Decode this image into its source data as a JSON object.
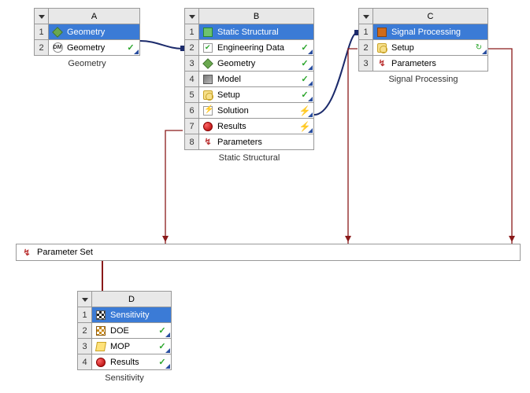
{
  "systems": {
    "A": {
      "letter": "A",
      "title": "Geometry",
      "caption": "Geometry",
      "rows": [
        {
          "n": "2",
          "icon": "dm",
          "label": "Geometry",
          "status": "check"
        }
      ]
    },
    "B": {
      "letter": "B",
      "title": "Static Structural",
      "caption": "Static Structural",
      "rows": [
        {
          "n": "2",
          "icon": "eng",
          "label": "Engineering Data",
          "status": "check"
        },
        {
          "n": "3",
          "icon": "cube",
          "label": "Geometry",
          "status": "check"
        },
        {
          "n": "4",
          "icon": "model",
          "label": "Model",
          "status": "check"
        },
        {
          "n": "5",
          "icon": "setup",
          "label": "Setup",
          "status": "check"
        },
        {
          "n": "6",
          "icon": "solution",
          "label": "Solution",
          "status": "bolt"
        },
        {
          "n": "7",
          "icon": "results",
          "label": "Results",
          "status": "bolt"
        },
        {
          "n": "8",
          "icon": "params",
          "label": "Parameters",
          "status": ""
        }
      ]
    },
    "C": {
      "letter": "C",
      "title": "Signal Processing",
      "caption": "Signal Processing",
      "rows": [
        {
          "n": "2",
          "icon": "setup",
          "label": "Setup",
          "status": "refresh"
        },
        {
          "n": "3",
          "icon": "params",
          "label": "Parameters",
          "status": ""
        }
      ]
    },
    "D": {
      "letter": "D",
      "title": "Sensitivity",
      "caption": "Sensitivity",
      "rows": [
        {
          "n": "2",
          "icon": "doe",
          "label": "DOE",
          "status": "check"
        },
        {
          "n": "3",
          "icon": "mop",
          "label": "MOP",
          "status": "check"
        },
        {
          "n": "4",
          "icon": "results",
          "label": "Results",
          "status": "check"
        }
      ]
    }
  },
  "title_icons": {
    "A": "cube",
    "B": "struct",
    "C": "signal",
    "D": "sens"
  },
  "param_bar": {
    "label": "Parameter Set"
  }
}
